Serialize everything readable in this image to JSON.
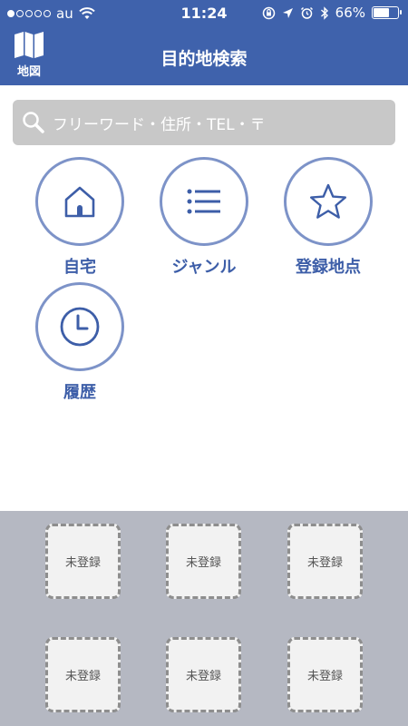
{
  "status": {
    "carrier": "au",
    "time": "11:24",
    "battery": "66%",
    "battery_level": 0.66,
    "signal_dots_filled": 1,
    "signal_dots_total": 5
  },
  "nav": {
    "map_label": "地図",
    "title": "目的地検索"
  },
  "search": {
    "placeholder": "フリーワード・住所・TEL・〒"
  },
  "shortcuts": [
    {
      "label": "自宅",
      "icon": "home-icon"
    },
    {
      "label": "ジャンル",
      "icon": "list-icon"
    },
    {
      "label": "登録地点",
      "icon": "star-icon"
    },
    {
      "label": "履歴",
      "icon": "clock-icon"
    }
  ],
  "slots": [
    {
      "label": "未登録"
    },
    {
      "label": "未登録"
    },
    {
      "label": "未登録"
    },
    {
      "label": "未登録"
    },
    {
      "label": "未登録"
    },
    {
      "label": "未登録"
    }
  ],
  "colors": {
    "nav_bg": "#3f62ac",
    "accent": "#3d5ea8",
    "circle_border": "#7d93c8",
    "bottom_bg": "#b5b8c2"
  }
}
